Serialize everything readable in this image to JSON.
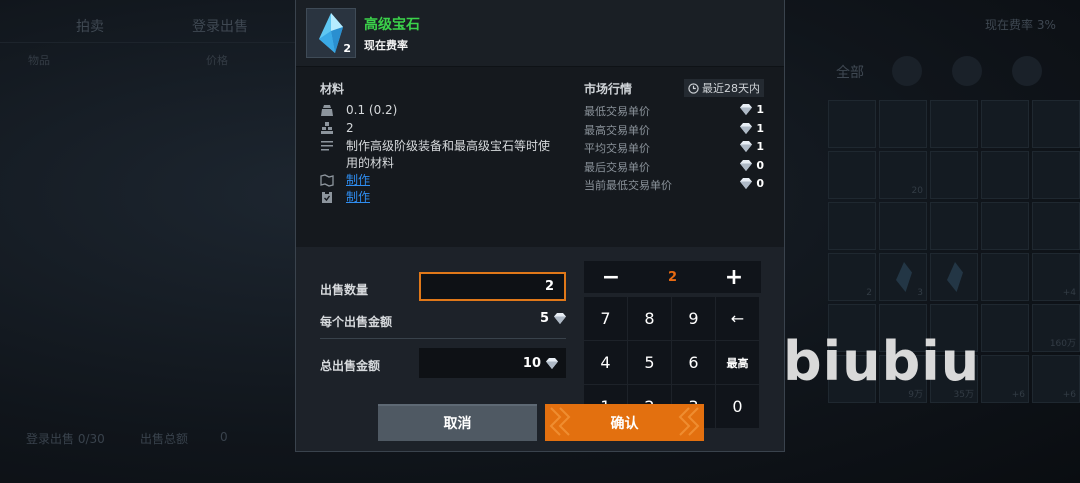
{
  "background": {
    "tabs": [
      "拍卖",
      "登录出售"
    ],
    "sub_headers": [
      "物品",
      "价格"
    ],
    "fee_label": "现在费率 3%",
    "category": "全部",
    "grid_counts": [
      "",
      "",
      "",
      "",
      "",
      "",
      "20",
      "",
      "",
      "",
      "",
      "",
      "",
      "",
      "",
      "2",
      "3",
      "",
      "",
      "+4",
      "",
      "",
      "",
      "",
      "160万",
      "",
      "9万",
      "35万",
      "+6",
      "+6"
    ],
    "footer_listed": "登录出售 0/30",
    "footer_total_label": "出售总额",
    "footer_total_value": "0",
    "watermark": "biubiu"
  },
  "dialog": {
    "item": {
      "name": "高级宝石",
      "count": "2",
      "subtitle": "现在费率",
      "name_color": "#3bd24a"
    },
    "materials": {
      "title": "材料",
      "weight": "0.1 (0.2)",
      "stack": "2",
      "description": "制作高级阶级装备和最高级宝石等时使用的材料",
      "link1": "制作",
      "link2": "制作"
    },
    "market": {
      "title": "市场行情",
      "period": "最近28天内",
      "rows": [
        {
          "label": "最低交易单价",
          "value": "1"
        },
        {
          "label": "最高交易单价",
          "value": "1"
        },
        {
          "label": "平均交易单价",
          "value": "1"
        },
        {
          "label": "最后交易单价",
          "value": "0"
        },
        {
          "label": "当前最低交易单价",
          "value": "0"
        }
      ]
    },
    "form": {
      "quantity_label": "出售数量",
      "quantity_value": "2",
      "unit_price_label": "每个出售金额",
      "unit_price_value": "5",
      "total_label": "总出售金额",
      "total_value": "10"
    },
    "keypad": {
      "minus": "−",
      "plus": "+",
      "display": "2",
      "keys": [
        "7",
        "8",
        "9",
        "←",
        "4",
        "5",
        "6",
        "最高",
        "1",
        "2",
        "3",
        "0"
      ]
    },
    "buttons": {
      "cancel": "取消",
      "confirm": "确认"
    },
    "colors": {
      "accent": "#e3700f",
      "link": "#2f8df0"
    }
  }
}
